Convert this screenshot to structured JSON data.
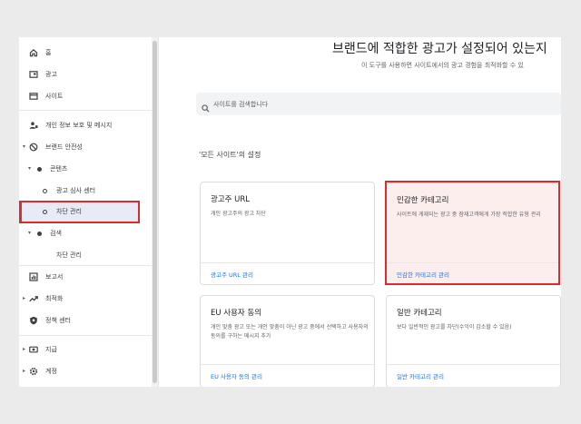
{
  "sidebar": {
    "items": [
      {
        "label": "홈",
        "icon": "home-icon"
      },
      {
        "label": "광고",
        "icon": "ads-icon"
      },
      {
        "label": "사이트",
        "icon": "sites-icon"
      },
      {
        "label": "개인 정보 보호 및 메시지",
        "icon": "privacy-icon"
      },
      {
        "label": "브랜드 안전성",
        "icon": "block-icon"
      },
      {
        "label": "콘텐츠"
      },
      {
        "label": "광고 심사 센터"
      },
      {
        "label": "차단 관리"
      },
      {
        "label": "검색"
      },
      {
        "label": "차단 관리"
      },
      {
        "label": "보고서",
        "icon": "reports-icon"
      },
      {
        "label": "최적화",
        "icon": "trending-icon"
      },
      {
        "label": "정책 센터",
        "icon": "policy-shield-icon"
      },
      {
        "label": "지급",
        "icon": "payments-icon"
      },
      {
        "label": "계정",
        "icon": "gear-icon"
      }
    ]
  },
  "main": {
    "title": "브랜드에 적합한 광고가 설정되어 있는지",
    "subtitle": "이 도구를 사용하면 사이트에서의 광고 경험을 최적화할 수 있",
    "search_placeholder": "사이트를 검색합니다",
    "section_title": "'모든 사이트'의 설정",
    "cards": [
      {
        "title": "광고주 URL",
        "desc": "개인 광고주의 광고 차단",
        "link": "광고주 URL 관리"
      },
      {
        "title": "민감한 카테고리",
        "desc": "사이트에 게재되는 광고 중 잠재고객에게 가장 적합한 유형 관리",
        "link": "민감한 카테고리 관리"
      },
      {
        "title": "EU 사용자 동의",
        "desc": "개인 맞춤 광고 또는 개인 맞춤이 아닌 광고 중에서 선택하고 사용자의 동의를 구하는 메시지 추가",
        "link": "EU 사용자 동의 관리"
      },
      {
        "title": "일반 카테고리",
        "desc": "보다 일반적인 광고를 차단(수익이 감소할 수 있음)",
        "link": "일반 카테고리 관리"
      }
    ]
  },
  "colors": {
    "accent": "#1a73e8",
    "highlight_box": "#d32f2f",
    "active_bg": "#e8eaf6",
    "pink_card": "#fdeeee"
  }
}
